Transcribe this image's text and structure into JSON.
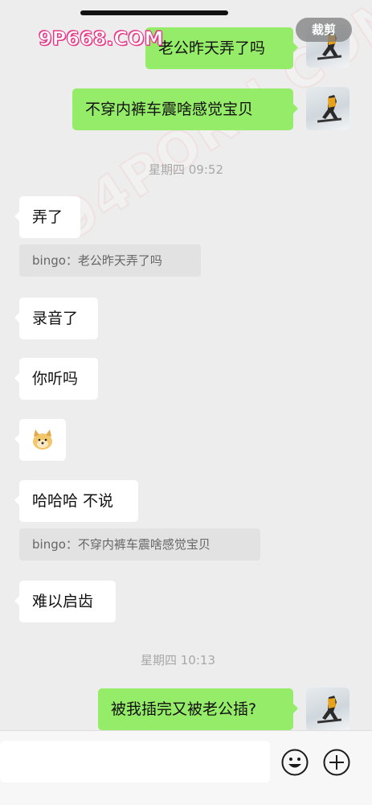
{
  "top": {
    "crop_label": "裁剪",
    "watermark": "9P668.COM",
    "watermark_large": "94PORN.COM"
  },
  "messages": [
    {
      "id": "m1",
      "text": "老公昨天弄了吗"
    },
    {
      "id": "m2",
      "text": "不穿内裤车震啥感觉宝贝"
    },
    {
      "id": "t1",
      "text": "星期四 09:52"
    },
    {
      "id": "m3",
      "text": "弄了"
    },
    {
      "id": "q1",
      "text": "bingo：老公昨天弄了吗"
    },
    {
      "id": "m4",
      "text": "录音了"
    },
    {
      "id": "m5",
      "text": "你听吗"
    },
    {
      "id": "m6",
      "emoji": "doge-sticker"
    },
    {
      "id": "m7",
      "text": "哈哈哈 不说"
    },
    {
      "id": "q2",
      "text": "bingo：不穿内裤车震啥感觉宝贝"
    },
    {
      "id": "m8",
      "text": "难以启齿"
    },
    {
      "id": "t2",
      "text": "星期四 10:13"
    },
    {
      "id": "m9",
      "text": "被我插完又被老公插?"
    }
  ],
  "input": {
    "emoji_icon": "smiley-icon",
    "plus_icon": "plus-icon"
  },
  "colors": {
    "outgoing_bubble": "#95ec69",
    "incoming_bubble": "#ffffff",
    "background": "#ededed"
  }
}
